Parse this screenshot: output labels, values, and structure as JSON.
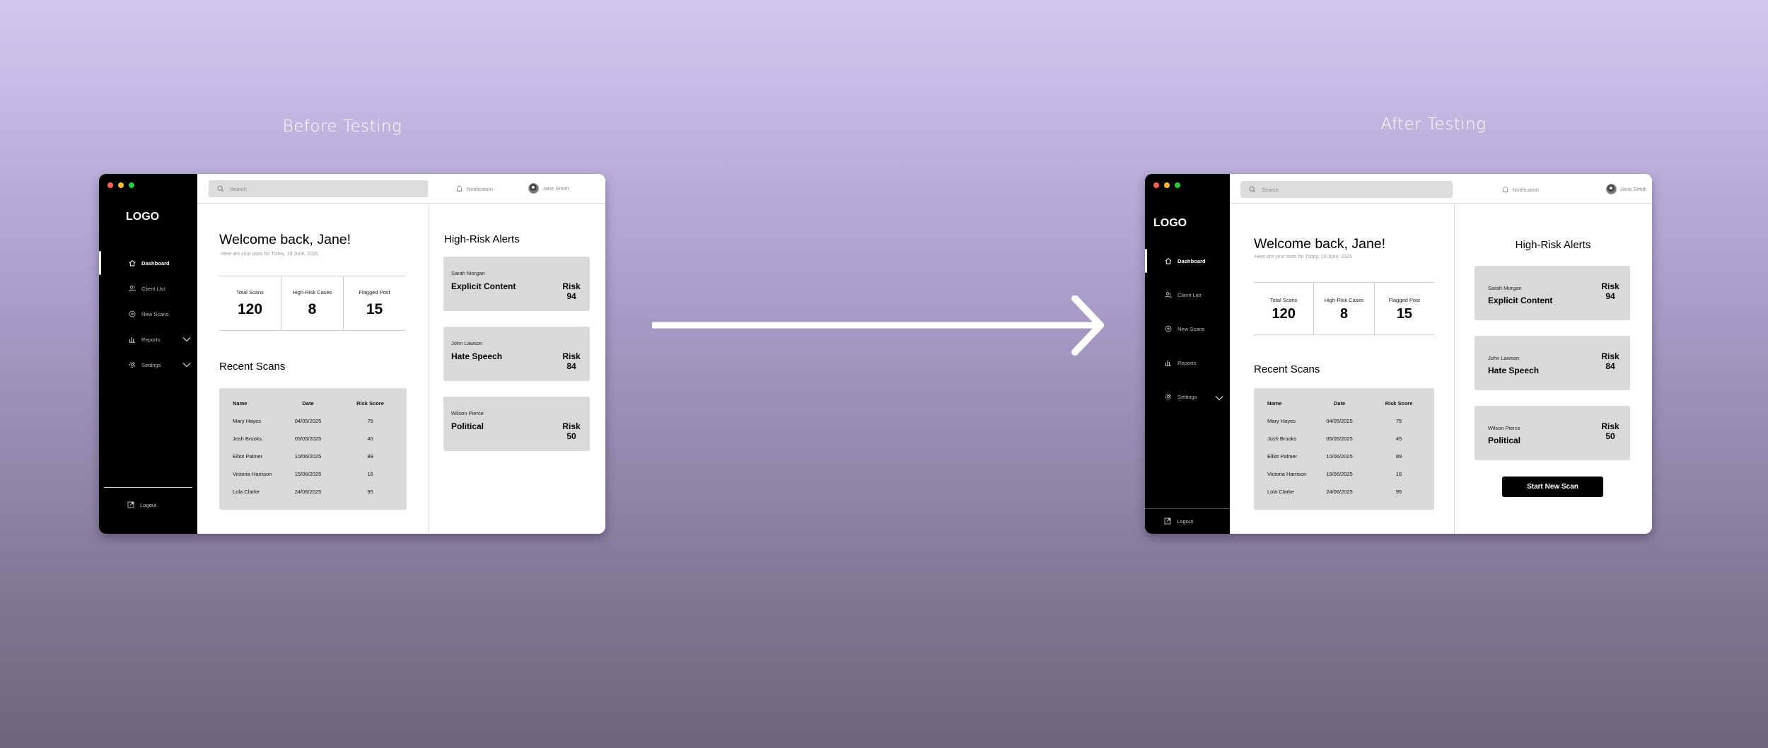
{
  "captions": {
    "before": "Before Testing",
    "after": "After Testing"
  },
  "window_dot_colors": [
    "#ff5f57",
    "#febc2e",
    "#28c840"
  ],
  "logo": "LOGO",
  "nav": {
    "dashboard": "Dashboard",
    "client_list": "Client List",
    "new_scans": "New Scans",
    "reports": "Reports",
    "settings": "Settings",
    "logout": "Logout"
  },
  "topbar": {
    "search_placeholder": "Search",
    "notification": "Notification",
    "user_name": "Jane Smith"
  },
  "welcome": {
    "title": "Welcome back, Jane!",
    "subtitle": "Here are your stats for Today, 19 June, 2025"
  },
  "stats": [
    {
      "label": "Total Scans",
      "value": "120"
    },
    {
      "label": "High-Risk Cases",
      "value": "8"
    },
    {
      "label": "Flagged Post",
      "value": "15"
    }
  ],
  "recent_scans": {
    "title": "Recent Scans",
    "columns": [
      "Name",
      "Date",
      "Risk Score"
    ],
    "rows": [
      [
        "Mary Hayes",
        "04/05/2025",
        "75"
      ],
      [
        "Josh Brooks",
        "05/05/2025",
        "45"
      ],
      [
        "Elliot Palmer",
        "10/06/2025",
        "89"
      ],
      [
        "Victoria Harrison",
        "15/06/2025",
        "16"
      ],
      [
        "Lola Clarke",
        "24/06/2025",
        "95"
      ]
    ]
  },
  "alerts": {
    "title": "High-Risk Alerts",
    "items": [
      {
        "name": "Sarah Morgan",
        "type": "Explicit Content",
        "risk_label": "Risk",
        "risk": "94"
      },
      {
        "name": "John Lawson",
        "type": "Hate Speech",
        "risk_label": "Risk",
        "risk": "84"
      },
      {
        "name": "Wilson Pierce",
        "type": "Political",
        "risk_label": "Risk",
        "risk": "50"
      }
    ]
  },
  "start_button": "Start New Scan"
}
